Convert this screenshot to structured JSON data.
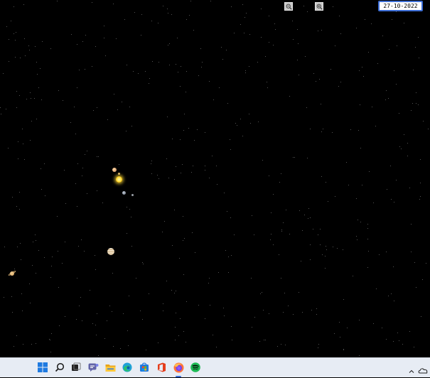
{
  "toolbar": {
    "zoom_out_icon": "zoom-out-magnifier-icon",
    "zoom_in_icon": "zoom-in-magnifier-icon",
    "date_value": "27-10-2022"
  },
  "solar_system": {
    "bodies": [
      "sun",
      "mercury",
      "venus",
      "earth",
      "mars",
      "jupiter",
      "saturn"
    ]
  },
  "taskbar": {
    "icons": [
      "windows-start-icon",
      "search-icon",
      "task-view-icon",
      "teams-chat-icon",
      "file-explorer-icon",
      "edge-browser-icon",
      "microsoft-store-icon",
      "office-icon",
      "firefox-icon",
      "spotify-icon"
    ],
    "active_app": "firefox",
    "tray_icons": [
      "show-hidden-icons-chevron-icon",
      "onedrive-icon"
    ]
  },
  "colors": {
    "background": "#000000",
    "taskbar": "#e7ecf4",
    "accent": "#3d6ed6",
    "sun": "#ffe34d"
  }
}
